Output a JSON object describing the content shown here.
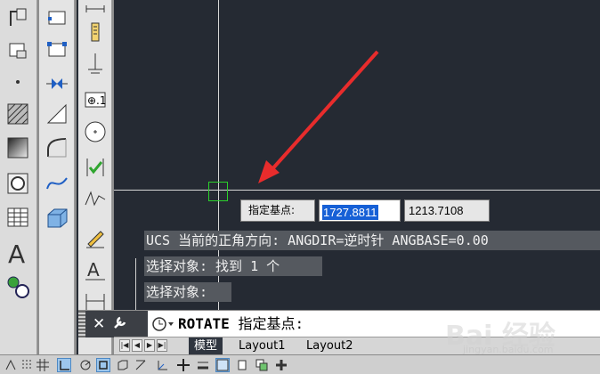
{
  "dynamic_input": {
    "prompt_label": "指定基点:",
    "x_value": "1727.8811",
    "y_value": "1213.7108"
  },
  "command_history": [
    "UCS 当前的正角方向:  ANGDIR=逆时针  ANGBASE=0.00",
    "选择对象: 找到 1 个",
    "选择对象:"
  ],
  "command_line": {
    "close_icon": "close-icon",
    "customize_icon": "wrench-icon",
    "recent_icon": "recent-commands-icon",
    "command": "ROTATE",
    "prompt": "指定基点:"
  },
  "layout_tabs": [
    "模型",
    "Layout1",
    "Layout2"
  ],
  "colors": {
    "canvas": "#252a33",
    "crosshair": "#d7d7d7",
    "pickbox": "#2bd12b",
    "selection": "#1660d6",
    "arrow": "#e82c2c"
  },
  "watermark": {
    "logo": "Bai 经验",
    "sub": "jingyan.baidu.com"
  }
}
